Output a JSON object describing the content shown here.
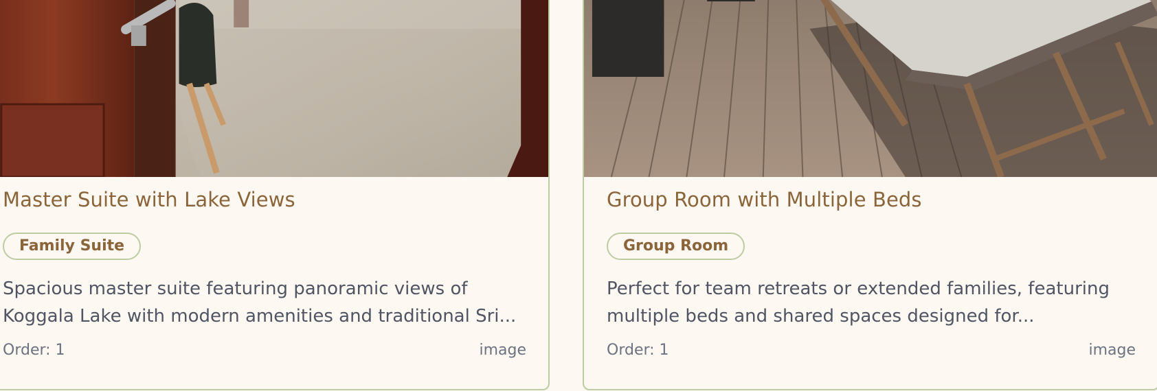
{
  "cards": [
    {
      "title": "Master Suite with Lake Views",
      "badge": "Family Suite",
      "description_lines": [
        "Spacious master suite featuring panoramic views of",
        "Koggala Lake with modern amenities and traditional Sri..."
      ],
      "order": "Order: 1",
      "media_type": "image"
    },
    {
      "title": "Group Room with Multiple Beds",
      "badge": "Group Room",
      "description_lines": [
        "Perfect for team retreats or extended families, featuring",
        "multiple beds and shared spaces designed for..."
      ],
      "order": "Order: 1",
      "media_type": "image"
    }
  ],
  "colors": {
    "background": "#fdf8f2",
    "title": "#8b6539",
    "card_border": "#bccca3",
    "description": "#4f5563",
    "meta": "#6b7280"
  }
}
